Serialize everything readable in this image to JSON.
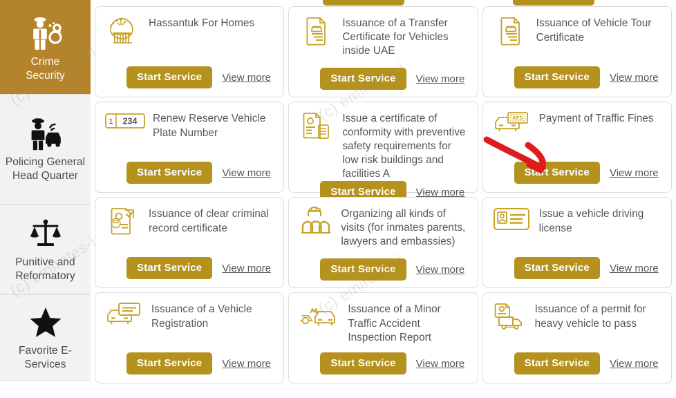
{
  "sidebar": {
    "items": [
      {
        "id": "crime-security",
        "label": "Crime\nSecurity",
        "label_line1": "Crime",
        "label_line2": "Security",
        "icon": "police-officer-handcuffs-icon",
        "active": true
      },
      {
        "id": "policing-general-head-quarter",
        "label": "Policing General Head Quarter",
        "icon": "police-officer-car-icon",
        "active": false
      },
      {
        "id": "punitive-and-reformatory",
        "label": "Punitive and Reformatory",
        "icon": "scales-of-justice-icon",
        "active": false
      },
      {
        "id": "favorite-e-services",
        "label": "Favorite E-Services",
        "icon": "star-icon",
        "active": false
      }
    ]
  },
  "main": {
    "buttons": {
      "start_label": "Start Service",
      "view_label": "View more"
    },
    "accent_color": "#b5911d",
    "active_nav_color": "#b4842c",
    "annotation": {
      "type": "arrow",
      "color": "#e01b1b",
      "points_to": "start-service-button-payment-of-traffic-fines"
    },
    "cards": [
      {
        "id": "hassantuk-for-homes",
        "title": "Hassantuk For Homes",
        "icon": "smoke-detector-alarm-icon",
        "start_label": "Start Service",
        "view_label": "View more"
      },
      {
        "id": "issuance-of-a-transfer-certificate-for-vehicles-inside-uae",
        "title": "Issuance of a Transfer Certificate for Vehicles inside UAE",
        "icon": "document-car-certificate-icon",
        "start_label": "Start Service",
        "view_label": "View more"
      },
      {
        "id": "issuance-of-vehicle-tour-certificate",
        "title": "Issuance of Vehicle Tour Certificate",
        "icon": "document-car-certificate-icon",
        "start_label": "Start Service",
        "view_label": "View more"
      },
      {
        "id": "renew-reserve-vehicle-plate-number",
        "title": "Renew Reserve Vehicle Plate Number",
        "icon": "license-plate-icon",
        "icon_text_left": "1",
        "icon_text_right": "234",
        "start_label": "Start Service",
        "view_label": "View more"
      },
      {
        "id": "issue-a-certificate-of-conformity-with-preventive-safety-requirements-for-low-risk-buildings-and-facilities-a",
        "title": "Issue a certificate of conformity with preventive safety requirements for low risk buildings and facilities A",
        "icon": "document-building-certificate-icon",
        "start_label": "Start Service",
        "view_label": "View more"
      },
      {
        "id": "payment-of-traffic-fines",
        "title": "Payment of Traffic Fines",
        "icon": "car-aed-banknote-icon",
        "icon_text": "AED",
        "start_label": "Start Service",
        "view_label": "View more"
      },
      {
        "id": "issuance-of-clear-criminal-record-certificate",
        "title": "Issuance of clear criminal record certificate",
        "icon": "criminal-record-fingerprint-icon",
        "start_label": "Start Service",
        "view_label": "View more"
      },
      {
        "id": "organizing-all-kinds-of-visits-for-inmates-parents-lawyers-and-embassies",
        "title": "Organizing all kinds of visits (for inmates parents, lawyers and embassies)",
        "icon": "prison-inmate-bars-icon",
        "start_label": "Start Service",
        "view_label": "View more"
      },
      {
        "id": "issue-a-vehicle-driving-license",
        "title": "Issue a vehicle driving license",
        "icon": "driving-license-card-icon",
        "start_label": "Start Service",
        "view_label": "View more"
      },
      {
        "id": "issuance-of-a-vehicle-registration",
        "title": "Issuance of a Vehicle Registration",
        "icon": "car-registration-card-icon",
        "start_label": "Start Service",
        "view_label": "View more"
      },
      {
        "id": "issuance-of-a-minor-traffic-accident-inspection-report",
        "title": "Issuance of a Minor Traffic Accident Inspection Report",
        "icon": "car-collision-icon",
        "start_label": "Start Service",
        "view_label": "View more"
      },
      {
        "id": "issuance-of-a-permit-for-heavy-vehicle-to-pass",
        "title": "Issuance of a permit for heavy vehicle to pass",
        "icon": "truck-permit-document-icon",
        "start_label": "Start Service",
        "view_label": "View more"
      }
    ]
  },
  "watermark": {
    "text": "(c) emirates-i"
  }
}
